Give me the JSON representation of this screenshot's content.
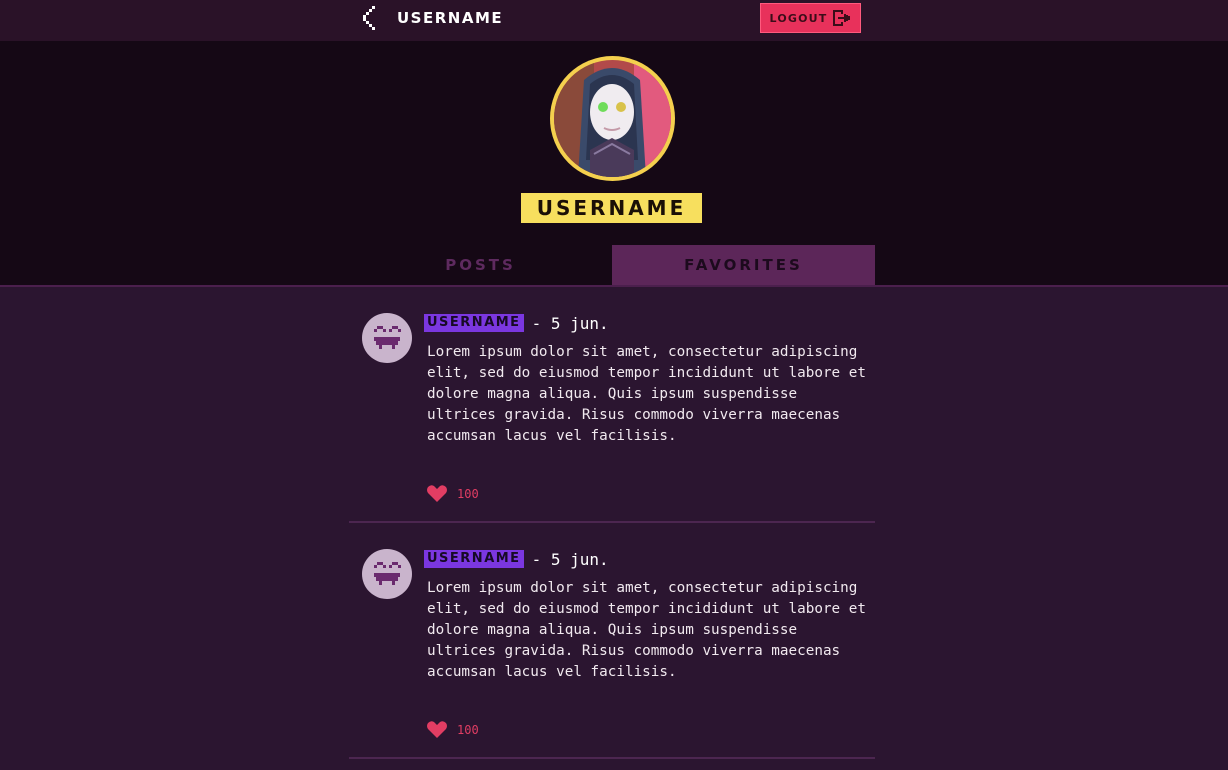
{
  "header": {
    "title": "USERNAME",
    "logout_label": "LOGOUT"
  },
  "profile": {
    "username": "USERNAME"
  },
  "tabs": [
    {
      "label": "POSTS",
      "active": false
    },
    {
      "label": "FAVORITES",
      "active": true
    }
  ],
  "posts": [
    {
      "username": "USERNAME",
      "date": "- 5 jun.",
      "body": "Lorem ipsum dolor sit amet, consectetur adipiscing elit, sed do eiusmod tempor incididunt ut labore et dolore magna aliqua. Quis ipsum suspendisse ultrices gravida. Risus commodo viverra maecenas accumsan lacus vel facilisis.",
      "likes": "100"
    },
    {
      "username": "USERNAME",
      "date": "- 5 jun.",
      "body": "Lorem ipsum dolor sit amet, consectetur adipiscing elit, sed do eiusmod tempor incididunt ut labore et dolore magna aliqua. Quis ipsum suspendisse ultrices gravida. Risus commodo viverra maecenas accumsan lacus vel facilisis.",
      "likes": "100"
    }
  ],
  "icons": {
    "back": "chevron-left-icon",
    "logout": "logout-icon",
    "post_avatar": "smiley-avatar-icon",
    "like": "heart-icon"
  },
  "colors": {
    "accent_pink": "#e8315b",
    "accent_yellow": "#f7df5e",
    "accent_purple": "#7b37e0",
    "background": "#2b1530"
  }
}
